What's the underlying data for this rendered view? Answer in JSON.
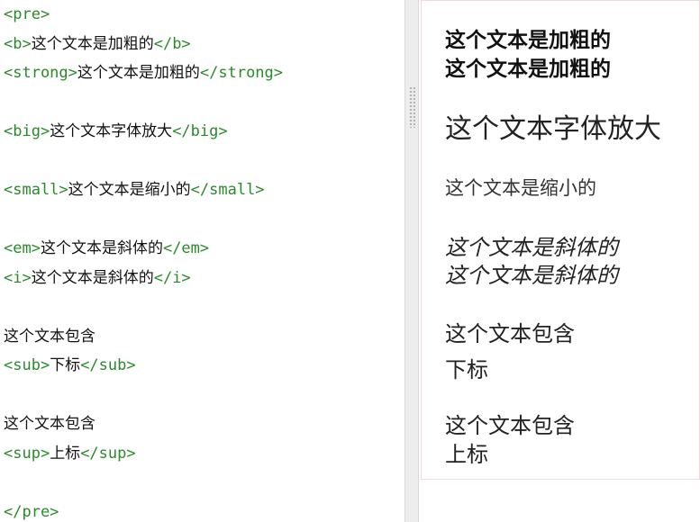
{
  "editor": {
    "lines": [
      {
        "parts": [
          {
            "t": "tag",
            "v": "<pre>"
          }
        ]
      },
      {
        "parts": [
          {
            "t": "tag",
            "v": "<b>"
          },
          {
            "t": "text",
            "v": "这个文本是加粗的"
          },
          {
            "t": "tag",
            "v": "</b>"
          }
        ]
      },
      {
        "parts": [
          {
            "t": "tag",
            "v": "<strong>"
          },
          {
            "t": "text",
            "v": "这个文本是加粗的"
          },
          {
            "t": "tag",
            "v": "</strong>"
          }
        ]
      },
      {
        "parts": []
      },
      {
        "parts": [
          {
            "t": "tag",
            "v": "<big>"
          },
          {
            "t": "text",
            "v": "这个文本字体放大"
          },
          {
            "t": "tag",
            "v": "</big>"
          }
        ]
      },
      {
        "parts": []
      },
      {
        "parts": [
          {
            "t": "tag",
            "v": "<small>"
          },
          {
            "t": "text",
            "v": "这个文本是缩小的"
          },
          {
            "t": "tag",
            "v": "</small>"
          }
        ]
      },
      {
        "parts": []
      },
      {
        "parts": [
          {
            "t": "tag",
            "v": "<em>"
          },
          {
            "t": "text",
            "v": "这个文本是斜体的"
          },
          {
            "t": "tag",
            "v": "</em>"
          }
        ]
      },
      {
        "parts": [
          {
            "t": "tag",
            "v": "<i>"
          },
          {
            "t": "text",
            "v": "这个文本是斜体的"
          },
          {
            "t": "tag",
            "v": "</i>"
          }
        ]
      },
      {
        "parts": []
      },
      {
        "parts": [
          {
            "t": "text",
            "v": "这个文本包含"
          }
        ]
      },
      {
        "parts": [
          {
            "t": "tag",
            "v": "<sub>"
          },
          {
            "t": "text",
            "v": "下标"
          },
          {
            "t": "tag",
            "v": "</sub>"
          }
        ]
      },
      {
        "parts": []
      },
      {
        "parts": [
          {
            "t": "text",
            "v": "这个文本包含"
          }
        ]
      },
      {
        "parts": [
          {
            "t": "tag",
            "v": "<sup>"
          },
          {
            "t": "text",
            "v": "上标"
          },
          {
            "t": "tag",
            "v": "</sup>"
          }
        ]
      },
      {
        "parts": []
      },
      {
        "parts": [
          {
            "t": "tag",
            "v": "</pre>"
          }
        ]
      }
    ]
  },
  "preview": {
    "bold_1": "这个文本是加粗的",
    "bold_2": "这个文本是加粗的",
    "big": "这个文本字体放大",
    "small": "这个文本是缩小的",
    "italic_1": "这个文本是斜体的",
    "italic_2": "这个文本是斜体的",
    "sub_text": "这个文本包含",
    "sub_label": "下标",
    "sup_text": "这个文本包含",
    "sup_label": "上标"
  },
  "colors": {
    "tag": "#2a8a2a",
    "text": "#111111",
    "preview_border": "#f7d7df",
    "splitter": "#ededed"
  }
}
